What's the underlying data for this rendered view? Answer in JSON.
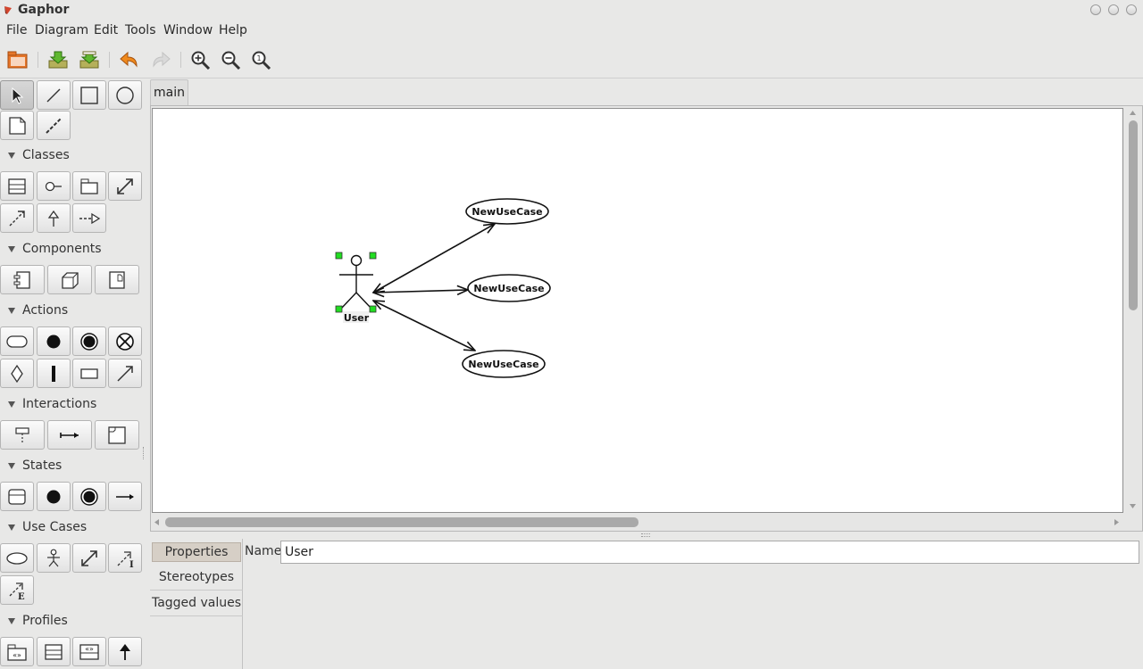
{
  "app": {
    "title": "Gaphor"
  },
  "menu": [
    "File",
    "Diagram",
    "Edit",
    "Tools",
    "Window",
    "Help"
  ],
  "toolbar": {
    "buttons": [
      "open-icon",
      "import-icon",
      "export-icon",
      "undo-icon",
      "redo-icon",
      "zoom-in-icon",
      "zoom-out-icon",
      "zoom-reset-icon"
    ]
  },
  "palette": {
    "sections": [
      {
        "label": "Classes"
      },
      {
        "label": "Components"
      },
      {
        "label": "Actions"
      },
      {
        "label": "Interactions"
      },
      {
        "label": "States"
      },
      {
        "label": "Use Cases"
      },
      {
        "label": "Profiles"
      }
    ]
  },
  "diagram": {
    "tab": "main",
    "actor": {
      "label": "User"
    },
    "usecases": [
      {
        "label": "NewUseCase"
      },
      {
        "label": "NewUseCase"
      },
      {
        "label": "NewUseCase"
      }
    ]
  },
  "properties": {
    "tabs": [
      "Properties",
      "Stereotypes",
      "Tagged values"
    ],
    "name_label": "Name",
    "name_value": "User"
  },
  "colors": {
    "selection_handle": "#22dd22",
    "canvas": "#ffffff",
    "chrome": "#e8e8e7"
  }
}
